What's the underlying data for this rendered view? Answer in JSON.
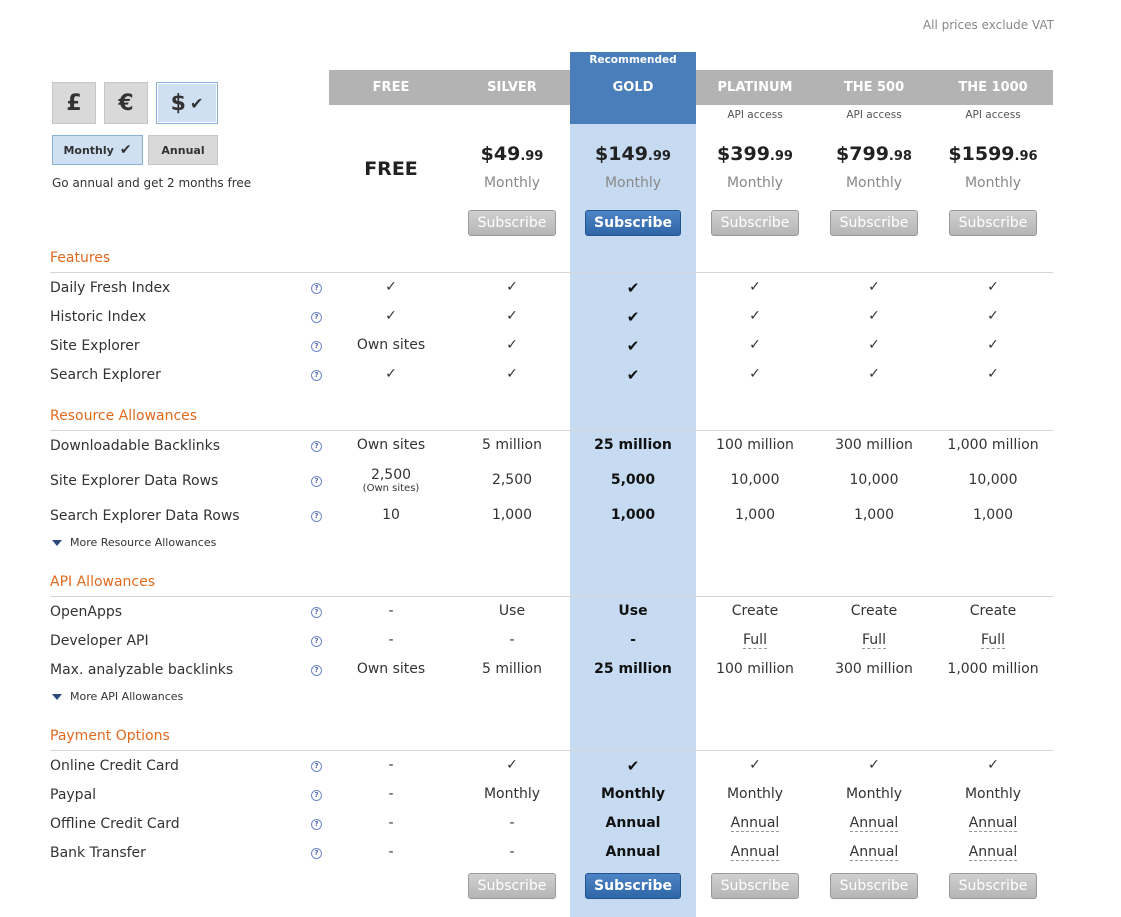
{
  "vat_note": "All prices exclude VAT",
  "currency": {
    "options": [
      {
        "symbol": "£",
        "active": false
      },
      {
        "symbol": "€",
        "active": false
      },
      {
        "symbol": "$",
        "active": true
      }
    ]
  },
  "billing": {
    "monthly_label": "Monthly",
    "annual_label": "Annual",
    "note": "Go annual and get 2 months free"
  },
  "recommended_label": "Recommended",
  "check": "✓",
  "check_bold": "✔",
  "plans": [
    {
      "name": "FREE",
      "api": "",
      "price_main": "",
      "price_cents": "",
      "free_label": "FREE",
      "period": "",
      "subscribe": ""
    },
    {
      "name": "SILVER",
      "api": "",
      "price_main": "$49",
      "price_cents": ".99",
      "period": "Monthly",
      "subscribe": "Subscribe"
    },
    {
      "name": "GOLD",
      "api": "",
      "price_main": "$149",
      "price_cents": ".99",
      "period": "Monthly",
      "subscribe": "Subscribe"
    },
    {
      "name": "PLATINUM",
      "api": "API access",
      "price_main": "$399",
      "price_cents": ".99",
      "period": "Monthly",
      "subscribe": "Subscribe"
    },
    {
      "name": "THE 500",
      "api": "API access",
      "price_main": "$799",
      "price_cents": ".98",
      "period": "Monthly",
      "subscribe": "Subscribe"
    },
    {
      "name": "THE 1000",
      "api": "API access",
      "price_main": "$1599",
      "price_cents": ".96",
      "period": "Monthly",
      "subscribe": "Subscribe"
    }
  ],
  "help_glyph": "?",
  "sections": [
    {
      "title": "Features",
      "rows": [
        {
          "label": "Daily Fresh Index",
          "cells": [
            "✓",
            "✓",
            "✔",
            "✓",
            "✓",
            "✓"
          ]
        },
        {
          "label": "Historic Index",
          "cells": [
            "✓",
            "✓",
            "✔",
            "✓",
            "✓",
            "✓"
          ]
        },
        {
          "label": "Site Explorer",
          "cells": [
            "Own sites",
            "✓",
            "✔",
            "✓",
            "✓",
            "✓"
          ]
        },
        {
          "label": "Search Explorer",
          "cells": [
            "✓",
            "✓",
            "✔",
            "✓",
            "✓",
            "✓"
          ]
        }
      ]
    },
    {
      "title": "Resource Allowances",
      "more": "More Resource Allowances",
      "rows": [
        {
          "label": "Downloadable Backlinks",
          "cells": [
            "Own sites",
            "5 million",
            "25 million",
            "100 million",
            "300 million",
            "1,000 million"
          ]
        },
        {
          "label": "Site Explorer Data Rows",
          "cells": [
            "2,500",
            "2,500",
            "5,000",
            "10,000",
            "10,000",
            "10,000"
          ],
          "free_sub": "(Own sites)"
        },
        {
          "label": "Search Explorer Data Rows",
          "cells": [
            "10",
            "1,000",
            "1,000",
            "1,000",
            "1,000",
            "1,000"
          ]
        }
      ]
    },
    {
      "title": "API Allowances",
      "more": "More API Allowances",
      "rows": [
        {
          "label": "OpenApps",
          "cells": [
            "-",
            "Use",
            "Use",
            "Create",
            "Create",
            "Create"
          ]
        },
        {
          "label": "Developer API",
          "cells": [
            "-",
            "-",
            "-",
            "Full",
            "Full",
            "Full"
          ]
        },
        {
          "label": "Max. analyzable backlinks",
          "cells": [
            "Own sites",
            "5 million",
            "25 million",
            "100 million",
            "300 million",
            "1,000 million"
          ]
        }
      ]
    },
    {
      "title": "Payment Options",
      "rows": [
        {
          "label": "Online Credit Card",
          "cells": [
            "-",
            "✓",
            "✔",
            "✓",
            "✓",
            "✓"
          ]
        },
        {
          "label": "Paypal",
          "cells": [
            "-",
            "Monthly",
            "Monthly",
            "Monthly",
            "Monthly",
            "Monthly"
          ]
        },
        {
          "label": "Offline Credit Card",
          "cells": [
            "-",
            "-",
            "Annual",
            "Annual",
            "Annual",
            "Annual"
          ]
        },
        {
          "label": "Bank Transfer",
          "cells": [
            "-",
            "-",
            "Annual",
            "Annual",
            "Annual",
            "Annual"
          ]
        }
      ]
    }
  ],
  "bottom_subscribe": [
    "",
    "Subscribe",
    "Subscribe",
    "Subscribe",
    "Subscribe",
    "Subscribe"
  ]
}
